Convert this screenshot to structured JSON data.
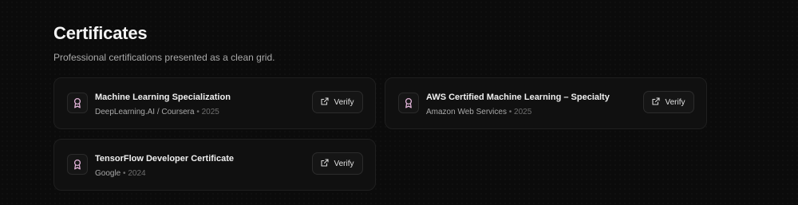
{
  "header": {
    "title": "Certificates",
    "subtitle": "Professional certifications presented as a clean grid."
  },
  "certificates": [
    {
      "name": "Machine Learning Specialization",
      "issuer": "DeepLearning.AI / Coursera",
      "separator": "•",
      "year": "2025",
      "verify_label": "Verify"
    },
    {
      "name": "AWS Certified Machine Learning – Specialty",
      "issuer": "Amazon Web Services",
      "separator": "•",
      "year": "2025",
      "verify_label": "Verify"
    },
    {
      "name": "TensorFlow Developer Certificate",
      "issuer": "Google",
      "separator": "•",
      "year": "2024",
      "verify_label": "Verify"
    }
  ],
  "icons": {
    "badge": "award-icon",
    "verify": "external-link-icon"
  },
  "colors": {
    "background": "#0b0b0b",
    "card": "#101010",
    "accent": "#e1b3d8"
  }
}
